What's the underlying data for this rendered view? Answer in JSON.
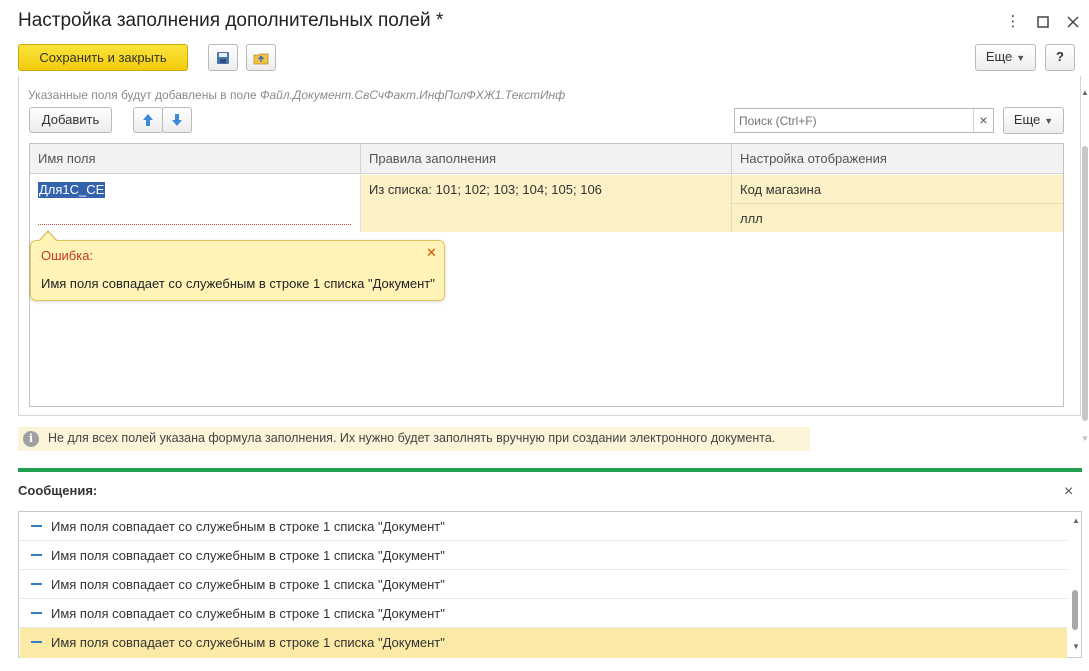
{
  "window": {
    "title": "Настройка заполнения дополнительных полей *",
    "menu_icon": "⋮",
    "maximize_icon": "☐",
    "close_icon": "✕"
  },
  "toolbar": {
    "save_close_label": "Сохранить и закрыть",
    "more_label": "Еще",
    "help_label": "?"
  },
  "hint": {
    "prefix": "Указанные поля будут добавлены в поле",
    "path": "Файл.Документ.СвСчФакт.ИнфПолФХЖ1.ТекстИнф"
  },
  "table_toolbar": {
    "add_label": "Добавить",
    "search_placeholder": "Поиск (Ctrl+F)",
    "search_clear": "×",
    "more_label": "Еще"
  },
  "grid": {
    "columns": [
      "Имя поля",
      "Правила заполнения",
      "Настройка отображения"
    ],
    "rows": [
      {
        "field_name": "Для1С_СЕ",
        "rule": "Из списка: 101; 102; 103; 104; 105; 106",
        "display": [
          "Код магазина",
          "ллл"
        ]
      }
    ]
  },
  "error_tooltip": {
    "title": "Ошибка:",
    "text": "Имя поля совпадает со служебным в строке 1 списка \"Документ\"",
    "close": "✕"
  },
  "notice": {
    "icon": "i",
    "text": "Не для всех полей указана формула заполнения. Их нужно будет заполнять вручную при создании электронного документа."
  },
  "messages": {
    "title": "Сообщения:",
    "close": "×",
    "items": [
      "Имя поля совпадает со служебным в строке 1 списка \"Документ\"",
      "Имя поля совпадает со служебным в строке 1 списка \"Документ\"",
      "Имя поля совпадает со служебным в строке 1 списка \"Документ\"",
      "Имя поля совпадает со служебным в строке 1 списка \"Документ\"",
      "Имя поля совпадает со служебным в строке 1 списка \"Документ\""
    ],
    "selected_index": 4
  },
  "colors": {
    "primary_button": "#f2cc0c",
    "selected_row": "#fbe9a6",
    "row_highlight": "#fcf1c6",
    "accent_line": "#1f9e4e",
    "error_title": "#c0392b"
  }
}
